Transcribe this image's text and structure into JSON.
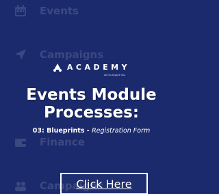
{
  "background_nav": {
    "items": [
      {
        "label": "Events",
        "icon": "calendar-icon"
      },
      {
        "label": "Campaigns",
        "icon": "send-icon"
      },
      {
        "label": "Finance",
        "icon": "wallet-icon"
      },
      {
        "label": "Campaigns",
        "icon": "people-icon"
      }
    ]
  },
  "logo": {
    "text": "ACADEMY",
    "tagline": "Let Us Inspire You"
  },
  "title": {
    "line1": "Events Module",
    "line2": "Processes:"
  },
  "subtitle": {
    "prefix": "03: Blueprints - ",
    "suffix": "Registration Form"
  },
  "cta": {
    "label": "Click Here"
  },
  "colors": {
    "background": "#1b2a6c",
    "text": "#ffffff"
  }
}
